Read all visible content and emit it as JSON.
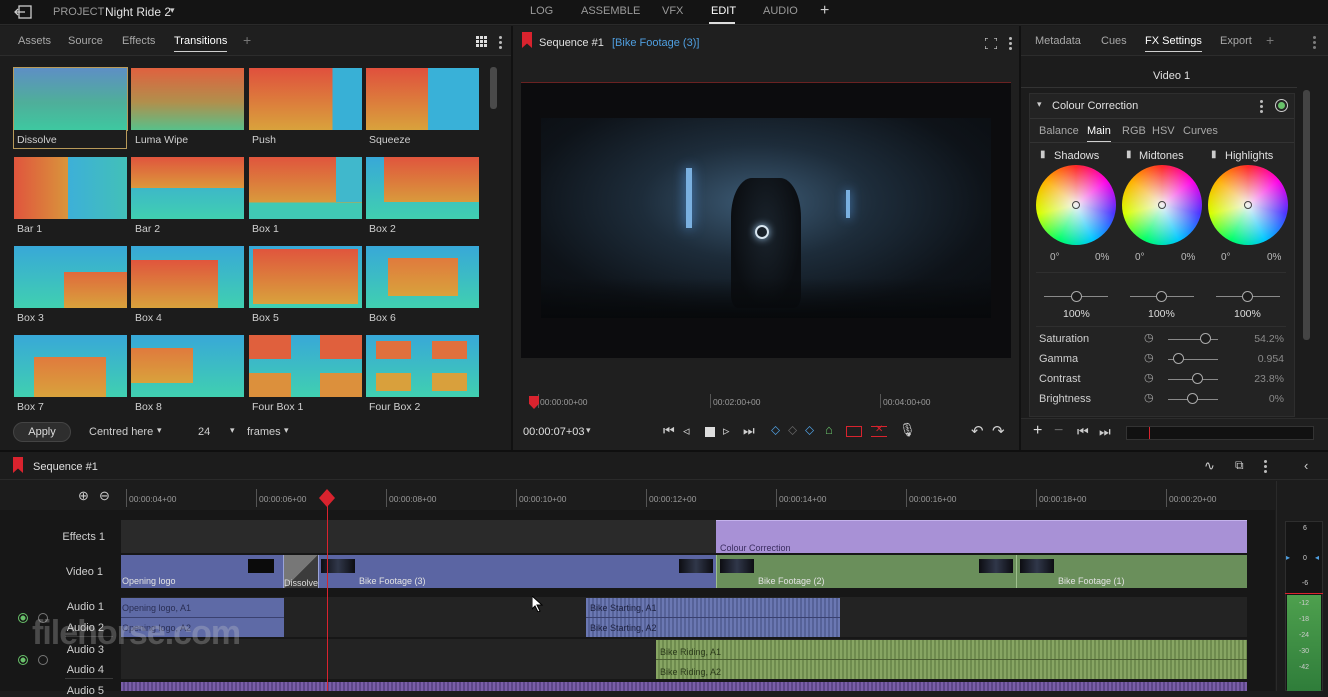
{
  "topbar": {
    "project_label": "PROJECT",
    "project_name": "Night Ride 2",
    "tabs": [
      "LOG",
      "ASSEMBLE",
      "VFX",
      "EDIT",
      "AUDIO"
    ],
    "active_tab": "EDIT",
    "add": "+"
  },
  "left_panel": {
    "tabs": [
      "Assets",
      "Source",
      "Effects",
      "Transitions"
    ],
    "active_tab": "Transitions",
    "add": "+",
    "transitions": [
      "Dissolve",
      "Luma Wipe",
      "Push",
      "Squeeze",
      "Bar 1",
      "Bar 2",
      "Box 1",
      "Box 2",
      "Box 3",
      "Box 4",
      "Box 5",
      "Box 6",
      "Box 7",
      "Box 8",
      "Four Box 1",
      "Four Box 2"
    ],
    "selected": "Dissolve",
    "apply_label": "Apply",
    "alignment": "Centred here",
    "duration": "24",
    "unit": "frames"
  },
  "viewer": {
    "title": "Sequence #1",
    "subtitle": "[Bike Footage (3)]",
    "ruler": [
      "00:00:00+00",
      "00:02:00+00",
      "00:04:00+00"
    ],
    "timecode": "00:00:07+03"
  },
  "right_panel": {
    "tabs": [
      "Metadata",
      "Cues",
      "FX Settings",
      "Export"
    ],
    "active_tab": "FX Settings",
    "add": "+",
    "track": "Video 1",
    "effect_name": "Colour Correction",
    "subtabs": [
      "Balance",
      "Main",
      "RGB",
      "HSV",
      "Curves"
    ],
    "active_subtab": "Main",
    "wheels": [
      {
        "name": "Shadows",
        "angle": "0°",
        "amount": "0%",
        "level": "100%"
      },
      {
        "name": "Midtones",
        "angle": "0°",
        "amount": "0%",
        "level": "100%"
      },
      {
        "name": "Highlights",
        "angle": "0°",
        "amount": "0%",
        "level": "100%"
      }
    ],
    "params": [
      {
        "name": "Saturation",
        "value": "54.2%"
      },
      {
        "name": "Gamma",
        "value": "0.954"
      },
      {
        "name": "Contrast",
        "value": "23.8%"
      },
      {
        "name": "Brightness",
        "value": "0%"
      }
    ],
    "remove": "−"
  },
  "timeline": {
    "title": "Sequence #1",
    "ruler": [
      "00:00:04+00",
      "00:00:06+00",
      "00:00:08+00",
      "00:00:10+00",
      "00:00:12+00",
      "00:00:14+00",
      "00:00:16+00",
      "00:00:18+00",
      "00:00:20+00"
    ],
    "tracks": [
      "Effects 1",
      "Video 1",
      "Audio 1",
      "Audio 2",
      "Audio 3",
      "Audio 4",
      "Audio 5"
    ],
    "clips": {
      "effect": "Colour Correction",
      "video": [
        "Opening logo",
        "Dissolve",
        "Bike Footage (3)",
        "Bike Footage (2)",
        "Bike Footage (1)"
      ],
      "audio": [
        "Opening logo, A1",
        "Opening logo, A2",
        "Bike Starting, A1",
        "Bike Starting, A2",
        "Bike Riding, A1",
        "Bike Riding, A2"
      ]
    },
    "meter": [
      "6",
      "0",
      "-6",
      "-12",
      "-18",
      "-24",
      "-30",
      "-42"
    ]
  },
  "watermark": "filehorse.com",
  "colors": {
    "accent_red": "#d9232e",
    "video_clip_blue": "#5b65a3",
    "video_clip_green": "#6a8f5b",
    "effect_purple": "#a891d6",
    "audio_blue": "#5e6aa6",
    "audio_green": "#7d9a5b",
    "fx_green": "#68c16a",
    "link_blue": "#4f9fe0"
  }
}
